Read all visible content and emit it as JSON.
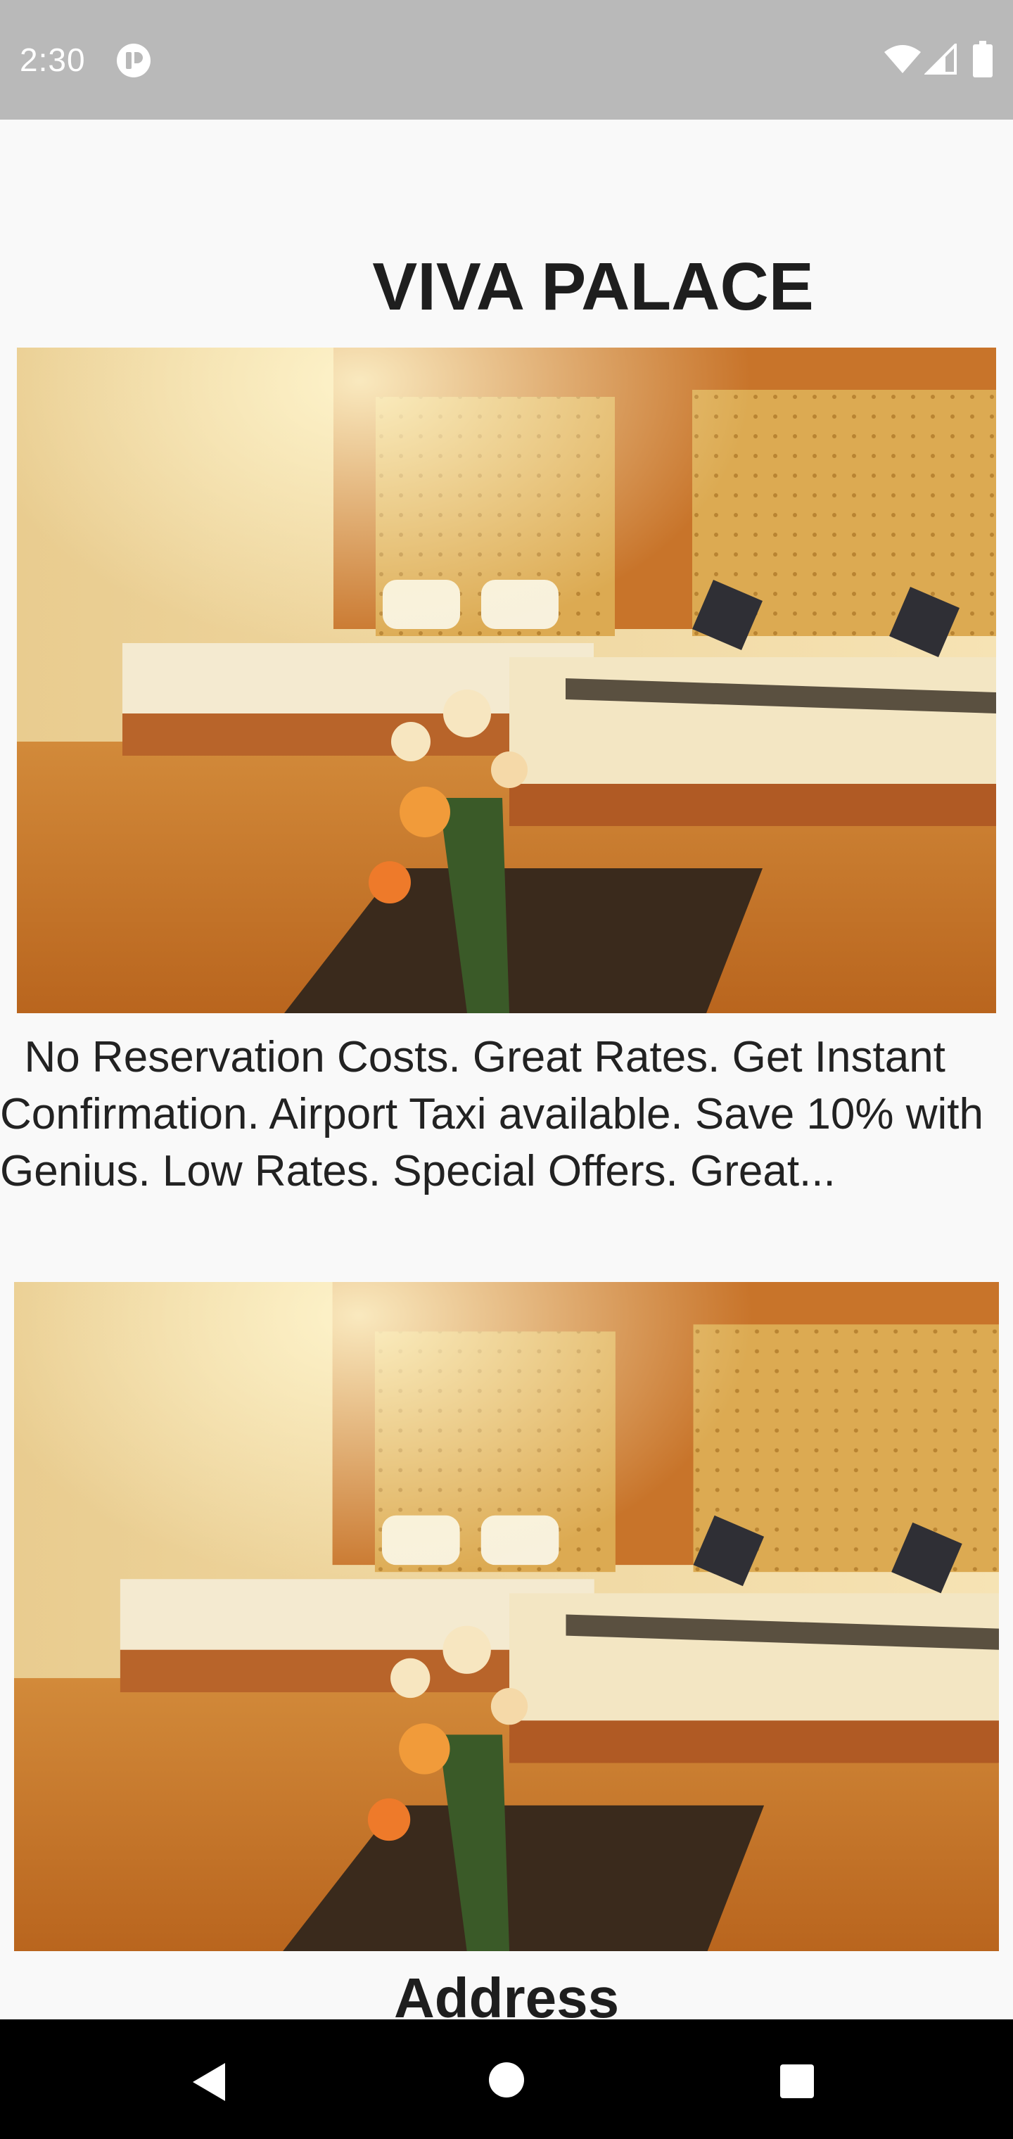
{
  "status_bar": {
    "time": "2:30",
    "icons": [
      "app-notification-icon",
      "wifi-icon",
      "cell-signal-icon",
      "battery-icon"
    ]
  },
  "hotel": {
    "name": "VIVA PALACE",
    "description": "  No Reservation Costs. Great Rates. Get Instant Confirmation. Airport Taxi available. Save 10% with Genius. Low Rates. Special Offers. Great...",
    "address_heading": "Address"
  },
  "images": [
    "hotel-room-photo",
    "hotel-room-photo"
  ],
  "nav_bar": {
    "buttons": [
      "back-icon",
      "home-icon",
      "recents-icon"
    ]
  },
  "colors": {
    "status_bar": "#b9b9b9",
    "background": "#f9f9f9",
    "nav_bar": "#000000",
    "wood": "#c97a2c",
    "headboard": "#d9a648"
  }
}
